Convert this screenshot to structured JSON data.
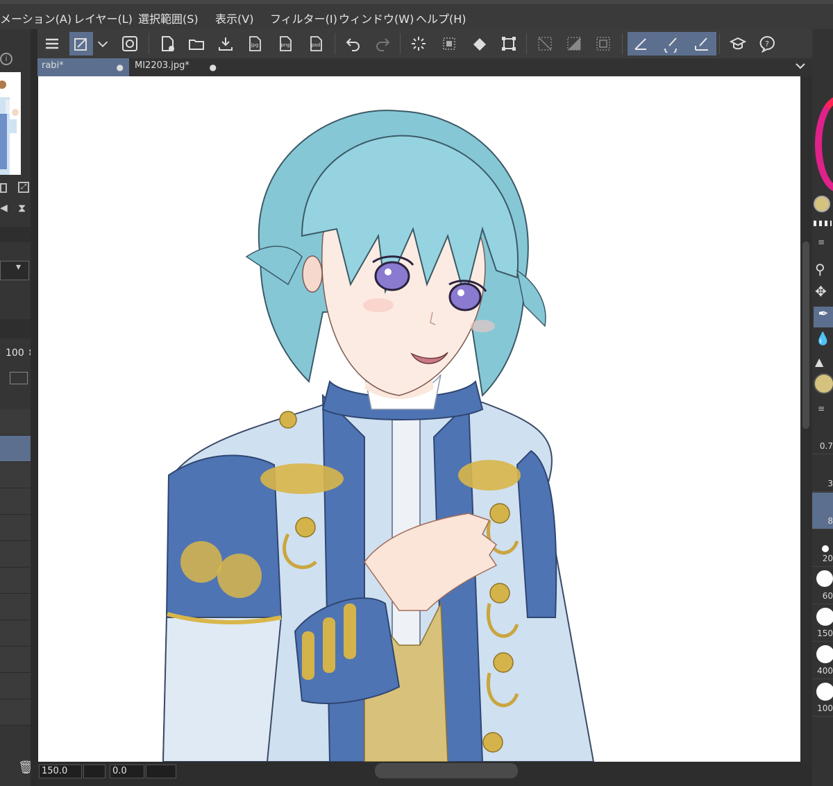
{
  "menubar": {
    "items": [
      {
        "label": "メーション(A)"
      },
      {
        "label": "レイヤー(L)"
      },
      {
        "label": "選択範囲(S)"
      },
      {
        "label": "表示(V)"
      },
      {
        "label": "フィルター(I)"
      },
      {
        "label": "ウィンドウ(W)"
      },
      {
        "label": "ヘルプ(H)"
      }
    ]
  },
  "tabs": [
    {
      "label": "rabi*",
      "active": true
    },
    {
      "label": "MI2203.jpg*",
      "active": false
    }
  ],
  "toolbar": {
    "export_labels": [
      "jpg",
      "png",
      "psd"
    ]
  },
  "left_panel": {
    "opacity_value": "100"
  },
  "statusbar": {
    "zoom_value": "150.0",
    "angle_value": "0.0"
  },
  "brush_sizes": [
    "0.7",
    "3",
    "8",
    "20",
    "60",
    "150",
    "400",
    "100"
  ],
  "colors": {
    "accent": "#5c6f8e",
    "main_color": "#d4c27e",
    "hair": "#8fd0db",
    "jacket": "#4f74b3",
    "gold": "#d8b64a"
  }
}
